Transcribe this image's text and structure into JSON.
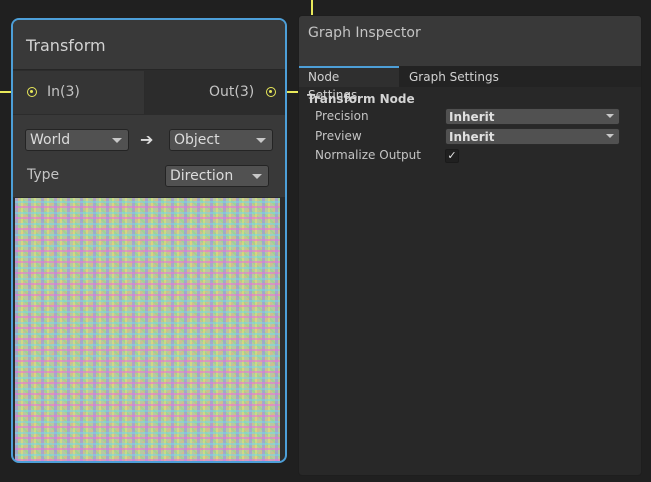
{
  "node": {
    "title": "Transform",
    "input_port": "In(3)",
    "output_port": "Out(3)",
    "from_space": "World",
    "to_space": "Object",
    "arrow": "➔",
    "type_label": "Type",
    "type_value": "Direction"
  },
  "inspector": {
    "title": "Graph Inspector",
    "tabs": [
      {
        "label": "Node Settings",
        "active": true
      },
      {
        "label": "Graph Settings",
        "active": false
      }
    ],
    "section_title": "Transform Node",
    "rows": {
      "precision_label": "Precision",
      "precision_value": "Inherit",
      "preview_label": "Preview",
      "preview_value": "Inherit",
      "normalize_label": "Normalize Output",
      "normalize_checked": true,
      "check_glyph": "✓"
    }
  },
  "colors": {
    "node_selected_border": "#4d9fd8",
    "edge": "#e8e85a"
  }
}
